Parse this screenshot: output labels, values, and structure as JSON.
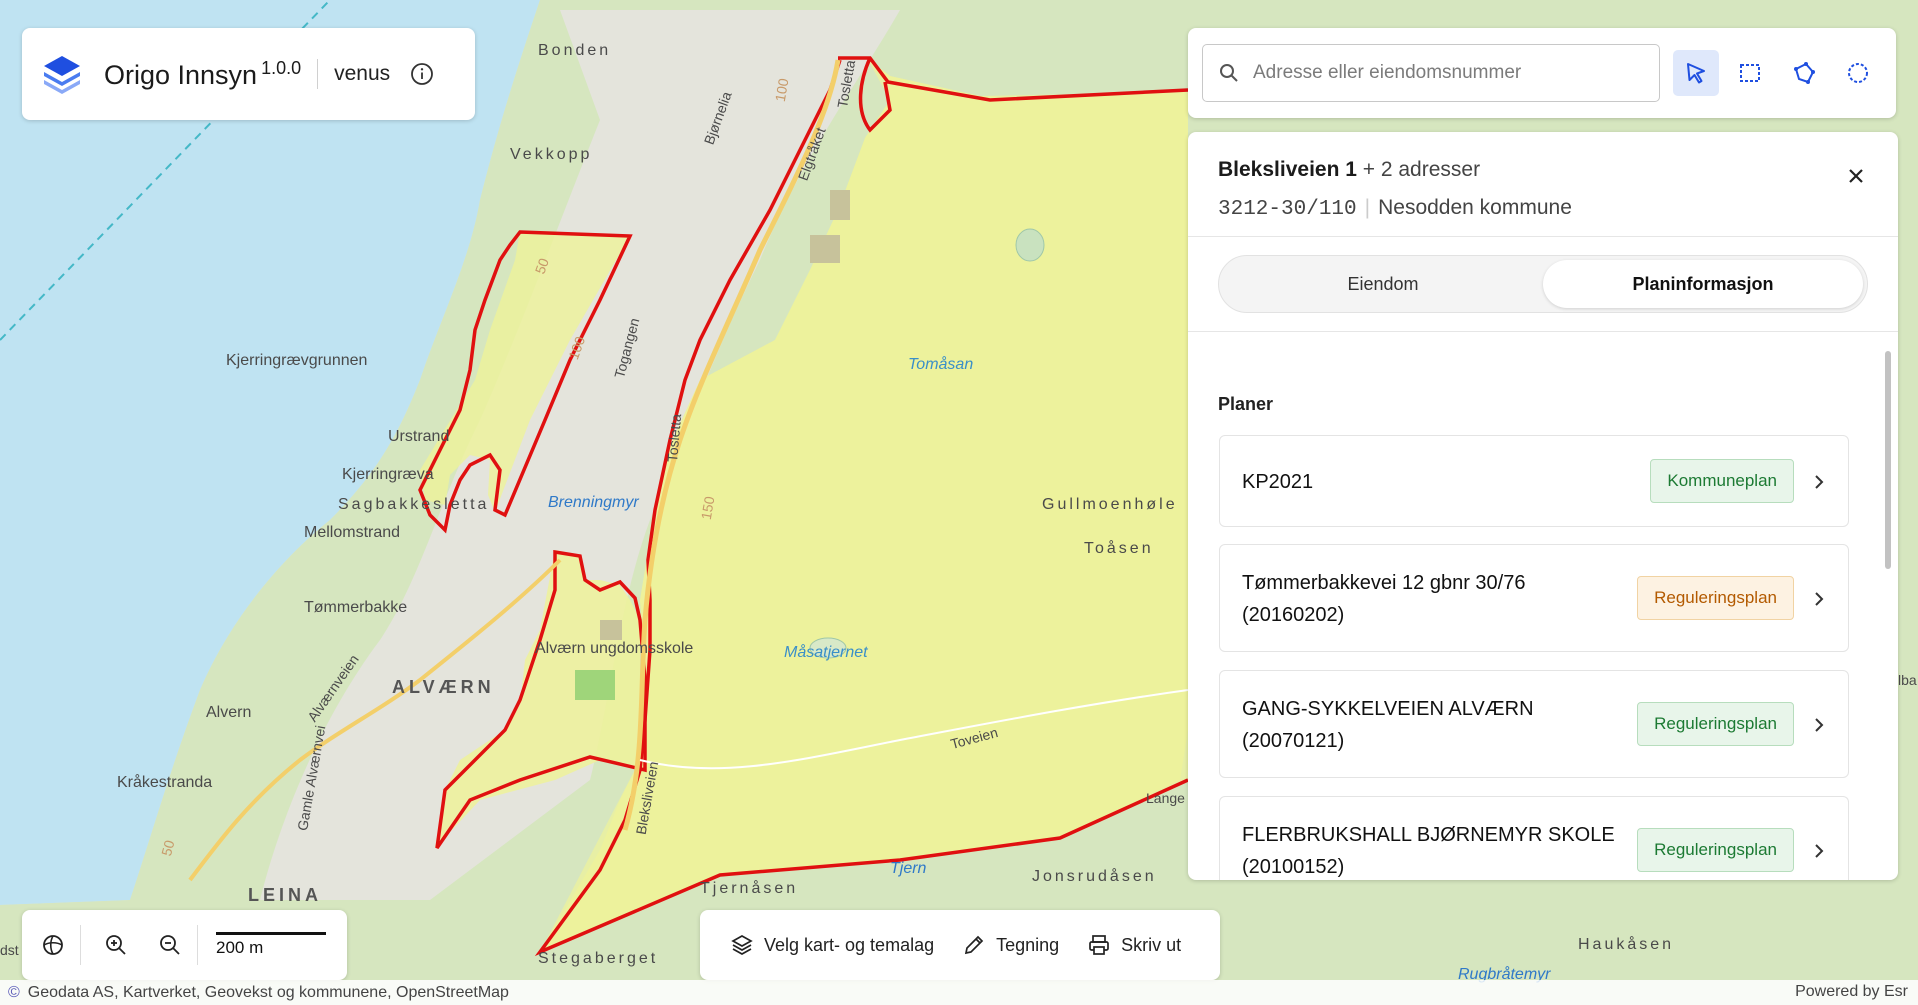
{
  "app": {
    "title": "Origo Innsyn",
    "version": "1.0.0",
    "environment": "venus"
  },
  "search": {
    "placeholder": "Adresse eller eiendomsnummer"
  },
  "property": {
    "address": "Bleksliveien 1",
    "more_addresses": "+ 2 adresser",
    "gnr": "3212-30/110",
    "municipality": "Nesodden kommune"
  },
  "tabs": [
    {
      "label": "Eiendom"
    },
    {
      "label": "Planinformasjon"
    }
  ],
  "plans_title": "Planer",
  "plans": [
    {
      "name": "KP2021",
      "badge": "Kommuneplan",
      "badge_color": "#1c7a33"
    },
    {
      "name": "Tømmerbakkevei 12 gbnr 30/76 (20160202)",
      "badge": "Reguleringsplan",
      "badge_color": "#b35a00"
    },
    {
      "name": "GANG-SYKKELVEIEN ALVÆRN (20070121)",
      "badge": "Reguleringsplan",
      "badge_color": "#1c7a33"
    },
    {
      "name": "FLERBRUKSHALL BJØRNEMYR SKOLE (20100152)",
      "badge": "Reguleringsplan",
      "badge_color": "#1c7a33"
    }
  ],
  "map_controls": {
    "scale": "200 m"
  },
  "bottom_tools": {
    "layers": "Velg kart- og temalag",
    "drawing": "Tegning",
    "print": "Skriv ut"
  },
  "attribution": {
    "text": "Geodata AS, Kartverket, Geovekst og kommunene, OpenStreetMap",
    "powered_by": "Powered by Esr"
  },
  "map_labels": {
    "bonden": "Bonden",
    "vekkopp": "Vekkopp",
    "kjerringraevgrunnen": "Kjerringrævgrunnen",
    "urstrand": "Urstrand",
    "kjerringraeva": "Kjerringræva",
    "sagbakkesletta": "Sagbakkesletta",
    "mellomstrand": "Mellomstrand",
    "tommerbakke": "Tømmerbakke",
    "alvaern": "ALVÆRN",
    "alvern": "Alvern",
    "krakestranda": "Kråkestranda",
    "leina": "LEINA",
    "brenningmyr": "Brenningmyr",
    "alvaern_skole": "Alværn ungdomsskole",
    "tomasan": "Tomåsan",
    "gullmoenhole": "Gullmoenhøle",
    "toasen": "Toåsen",
    "masatjernet": "Måsatjernet",
    "toveien": "Toveien",
    "tjernasen": "Tjernåsen",
    "jonsrudasen": "Jonsrudåsen",
    "tjern": "Tjern",
    "stegaberget": "Stegaberget",
    "haukasen": "Haukåsen",
    "rugbratemyr": "Rugbråtemyr",
    "bjornelia": "Bjørnelia",
    "elgtraket": "Elgtråket",
    "toslotta": "Tosletta",
    "togangen": "Togangen",
    "bleksliveien": "Bleksliveien",
    "gamle_alvaernvei": "Gamle Alværnvei",
    "alvaernveien": "Alværnveien",
    "c50a": "50",
    "c100": "100",
    "c150": "150",
    "c100b": "100",
    "c50b": "50",
    "dst": "dst",
    "lange": "Lange",
    "elba": "lba"
  }
}
